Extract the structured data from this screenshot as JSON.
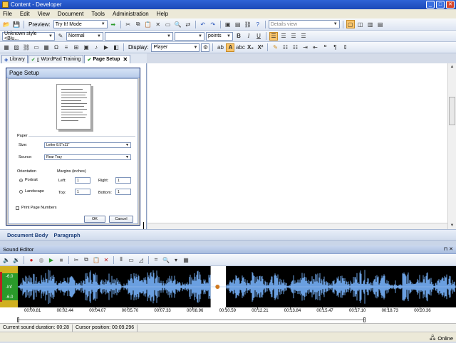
{
  "window": {
    "title": "Content - Developer"
  },
  "menu": [
    "File",
    "Edit",
    "View",
    "Document",
    "Tools",
    "Administration",
    "Help"
  ],
  "toolbar1": {
    "preview_label": "Preview:",
    "preview_mode": "Try It! Mode",
    "view_mode_placeholder": "Details view"
  },
  "toolbar2": {
    "style": "Unknown style <Blu...",
    "paragraph_style": "Normal",
    "font": "",
    "size": "",
    "size_unit": "points"
  },
  "toolbar3": {
    "display_label": "Display:",
    "display_value": "Player"
  },
  "tabs": [
    {
      "label": "Library"
    },
    {
      "label": "WordPad Training"
    },
    {
      "label": "Page Setup"
    }
  ],
  "page_setup": {
    "title": "Page Setup",
    "paper_label": "Paper",
    "size_label": "Size:",
    "size_value": "Letter 8.5\"x11\"",
    "source_label": "Source:",
    "source_value": "Rear Tray",
    "orientation_label": "Orientation",
    "portrait_label": "Portrait",
    "landscape_label": "Landscape",
    "margins_label": "Margins (inches)",
    "left_label": "Left:",
    "left_value": "1",
    "right_label": "Right:",
    "right_value": "1",
    "top_label": "Top:",
    "top_value": "1",
    "bottom_label": "Bottom:",
    "bottom_value": "1",
    "print_page_numbers_label": "Print Page Numbers",
    "ok_label": "OK",
    "cancel_label": "Cancel"
  },
  "doc_path": [
    "Document Body",
    "Paragraph"
  ],
  "sound_editor": {
    "title": "Sound Editor",
    "vu_labels": [
      "-6.0",
      "-Inf",
      "-6.0"
    ],
    "timeline": [
      "00:00.81",
      "00:02.44",
      "00:04.07",
      "00:05.70",
      "00:07.33",
      "00:08.96",
      "00:10.59",
      "00:12.21",
      "00:13.84",
      "00:15.47",
      "00:17.10",
      "00:18.73",
      "00:20.36"
    ],
    "duration_text": "Current sound duration: 00:28",
    "cursor_text": "Cursor position: 00:09.296",
    "selection_fraction": [
      0.44,
      0.475
    ]
  },
  "status": {
    "online_label": "Online"
  },
  "colors": {
    "accent": "#f9c56b",
    "wave": "#6a9fe0",
    "title_bar": "#1c49b8",
    "doc_path_text": "#1d3f7a"
  }
}
